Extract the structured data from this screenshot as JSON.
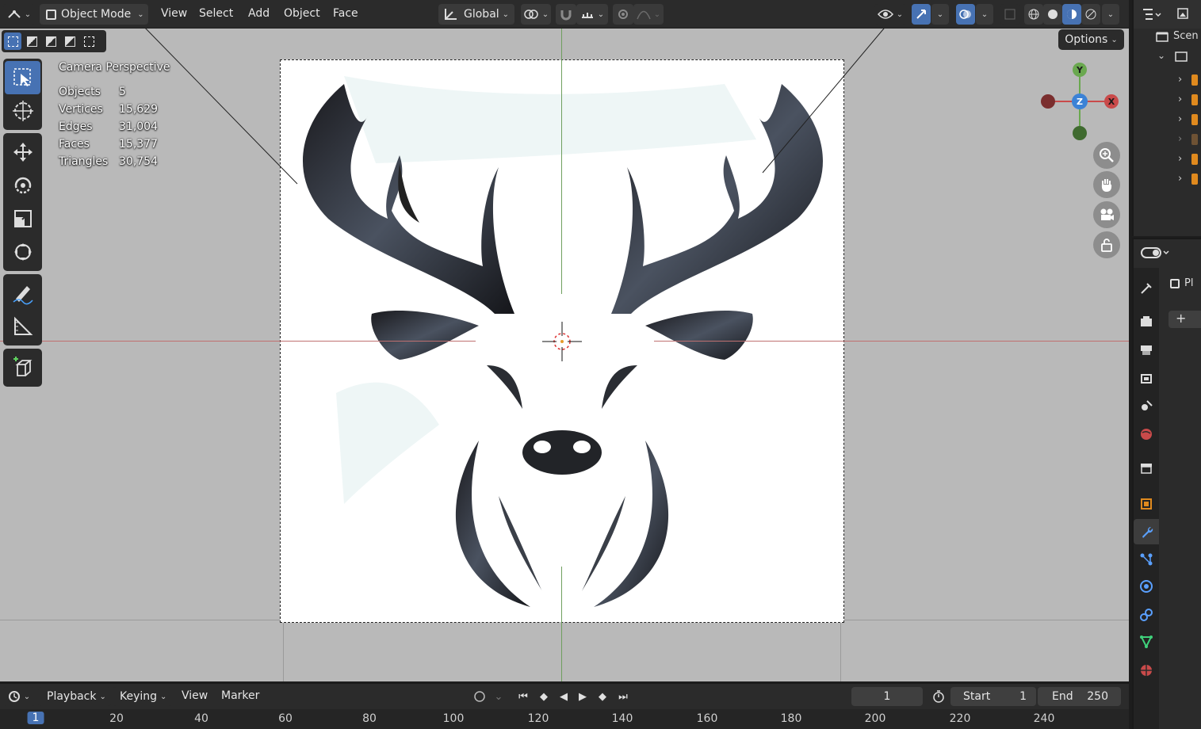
{
  "header": {
    "mode": "Object Mode",
    "menus": [
      "View",
      "Select",
      "Add",
      "Object",
      "Face"
    ],
    "transform_orientation": "Global"
  },
  "viewport": {
    "options_label": "Options",
    "overlay_title": "Camera Perspective",
    "stats": [
      {
        "label": "Objects",
        "value": "5"
      },
      {
        "label": "Vertices",
        "value": "15,629"
      },
      {
        "label": "Edges",
        "value": "31,004"
      },
      {
        "label": "Faces",
        "value": "15,377"
      },
      {
        "label": "Triangles",
        "value": "30,754"
      }
    ],
    "gizmo": {
      "x": "X",
      "y": "Y",
      "z": "Z"
    }
  },
  "outliner": {
    "scene_label": "Scen"
  },
  "properties": {
    "object_label": "Pl"
  },
  "timeline": {
    "menus": [
      "Playback",
      "Keying",
      "View",
      "Marker"
    ],
    "current_frame": "1",
    "start_label": "Start",
    "start_value": "1",
    "end_label": "End",
    "end_value": "250",
    "ticks": [
      "1",
      "20",
      "40",
      "60",
      "80",
      "100",
      "120",
      "140",
      "160",
      "180",
      "200",
      "220",
      "240"
    ]
  },
  "colors": {
    "accent": "#4772b3",
    "x_axis": "#c94a4a",
    "y_axis": "#6aa84f",
    "z_axis": "#3b82d6"
  }
}
